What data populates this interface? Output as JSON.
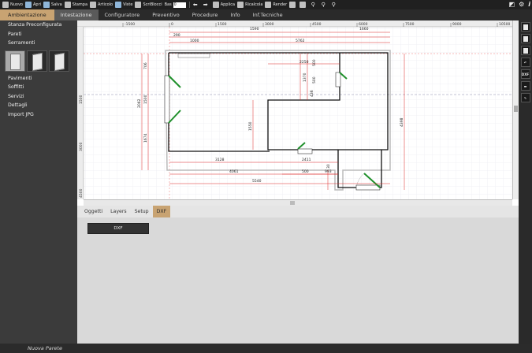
{
  "toolbar": {
    "items": [
      {
        "label": "Nuovo",
        "icon": "new-file-icon"
      },
      {
        "label": "Apri",
        "icon": "folder-icon"
      },
      {
        "label": "Salva",
        "icon": "save-icon"
      },
      {
        "label": "Stampa",
        "icon": "print-icon"
      },
      {
        "label": "Articolo",
        "icon": "list-icon"
      },
      {
        "label": "Viste",
        "icon": "view-icon"
      },
      {
        "label": "ScriBlocci",
        "icon": "blocks-icon"
      }
    ],
    "scala_label": "Bas",
    "scala_value": "0",
    "applica_label": "Applica",
    "ricalcola_label": "Ricalcola",
    "render_label": "Render"
  },
  "menu": {
    "tabs": [
      "Ambientazione",
      "Intestazione",
      "Configuratore",
      "Preventivo",
      "Procedure",
      "Info",
      "Inf.Tecniche"
    ]
  },
  "sidebar": {
    "items_top": [
      "Stanza Preconfigurata",
      "Pareti",
      "Serramenti"
    ],
    "items_bottom": [
      "Pavimenti",
      "Soffitti",
      "Servizi",
      "Dettagli",
      "Import JPG"
    ]
  },
  "ruler": {
    "top_ticks": [
      "-1500",
      "0",
      "1500",
      "3000",
      "4500",
      "6000",
      "7500",
      "9000",
      "10500"
    ],
    "left_ticks": [
      "1500",
      "3000",
      "4500"
    ]
  },
  "dimensions": {
    "top_290": "290",
    "top_1000": "1000",
    "top_5762": "5762",
    "top_1590": "1590",
    "top_1660": "1660",
    "v_706": "706",
    "v_2062": "2062",
    "v_1500": "1500",
    "v_1674": "1674",
    "v_500a": "500",
    "v_1370": "1370",
    "v_500b": "500",
    "v_436": "436",
    "h_2250": "2250",
    "v_1550": "1550",
    "v_4398": "4398",
    "h_3128": "3128",
    "h_2411": "2411",
    "h_4061": "4061",
    "h_500": "500",
    "h_993": "993",
    "h_5540": "5540",
    "v_30": "30"
  },
  "bottom": {
    "tabs": [
      "Oggetti",
      "Layers",
      "Setup",
      "DXF"
    ],
    "dxf_button": "DXF"
  },
  "status": {
    "text": "Nuova Parete"
  },
  "right_tools": [
    "new-page-icon",
    "folder-icon",
    "save-icon",
    "undo-icon",
    "DXF",
    "measure-icon",
    "edit-icon"
  ]
}
